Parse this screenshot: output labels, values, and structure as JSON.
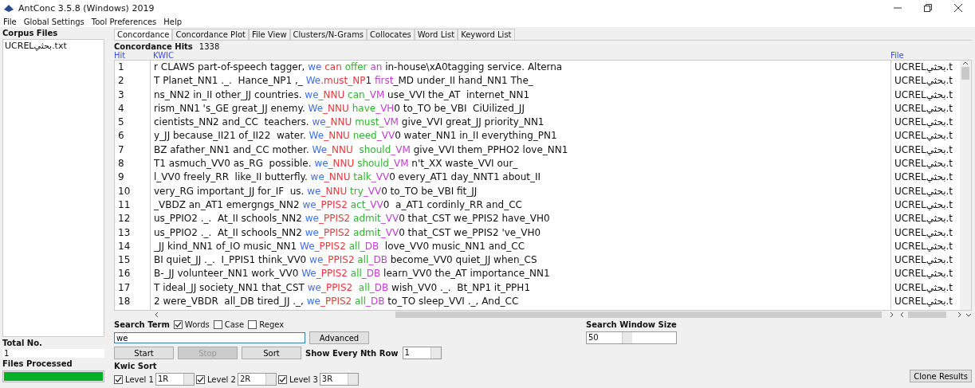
{
  "window": {
    "title": "AntConc 3.5.8 (Windows) 2019"
  },
  "menu": [
    "File",
    "Global Settings",
    "Tool Preferences",
    "Help"
  ],
  "sidebar": {
    "title": "Corpus Files",
    "files": [
      "UCRELبحثي.txt"
    ],
    "total_label": "Total No.",
    "total_value": "1",
    "processed_label": "Files Processed",
    "progress": {
      "level": 1
    }
  },
  "tabs": [
    {
      "label": "Concordance",
      "selected": true
    },
    {
      "label": "Concordance Plot",
      "selected": false
    },
    {
      "label": "File View",
      "selected": false
    },
    {
      "label": "Clusters/N-Grams",
      "selected": false
    },
    {
      "label": "Collocates",
      "selected": false
    },
    {
      "label": "Word List",
      "selected": false
    },
    {
      "label": "Keyword List",
      "selected": false
    }
  ],
  "hits": {
    "label": "Concordance Hits",
    "value": "1338"
  },
  "table": {
    "columns": [
      "Hit",
      "KWIC",
      "File"
    ],
    "rows": [
      {
        "hit": "1",
        "left": "r CLAWS part-of-speech tagger, ",
        "kwic": [
          {
            "text": "we",
            "color": "#3f6fe8"
          },
          {
            "text": " can",
            "color": "#e8383d"
          },
          {
            "text": " offer",
            "color": "#2fb52f"
          },
          {
            "text": " an",
            "color": "#c040d0"
          }
        ],
        "right": " in-house\\xA0tagging service. Alterna",
        "file": "UCRELبحثي.t"
      },
      {
        "hit": "2",
        "left": "T Planet_NN1 ._.  Hance_NP1 ,_ ",
        "kwic": [
          {
            "text": "We",
            "color": "#3f6fe8"
          },
          {
            "text": ".must_NP",
            "color": "#e8383d"
          },
          {
            "text": "1 ",
            "color": "#222222"
          },
          {
            "text": "first",
            "color": "#c040d0"
          }
        ],
        "right": "_MD under_II hand_NN1 The_",
        "file": "UCRELبحثي.t"
      },
      {
        "hit": "3",
        "left": "ns_NN2 in_II other_JJ countries. ",
        "kwic": [
          {
            "text": "we",
            "color": "#3f6fe8"
          },
          {
            "text": "_NNU",
            "color": "#e8383d"
          },
          {
            "text": " can",
            "color": "#2fb52f"
          },
          {
            "text": "_VM",
            "color": "#c040d0"
          }
        ],
        "right": " use_VVI the_AT  internet_NN1",
        "file": "UCRELبحثي.t"
      },
      {
        "hit": "4",
        "left": "rism_NN1 's_GE great_JJ enemy. ",
        "kwic": [
          {
            "text": "We",
            "color": "#3f6fe8"
          },
          {
            "text": "_NNU",
            "color": "#e8383d"
          },
          {
            "text": " have",
            "color": "#2fb52f"
          },
          {
            "text": "_VH",
            "color": "#c040d0"
          }
        ],
        "right": "0 to_TO be_VBI  CiUilized_JJ",
        "file": "UCRELبحثي.t"
      },
      {
        "hit": "5",
        "left": "cientists_NN2 and_CC  teachers. ",
        "kwic": [
          {
            "text": "we",
            "color": "#3f6fe8"
          },
          {
            "text": "_NNU",
            "color": "#e8383d"
          },
          {
            "text": " must",
            "color": "#2fb52f"
          },
          {
            "text": "_VM",
            "color": "#c040d0"
          }
        ],
        "right": " give_VVI great_JJ priority_NN1",
        "file": "UCRELبحثي.t"
      },
      {
        "hit": "6",
        "left": "y_JJ because_II21 of_II22  water. ",
        "kwic": [
          {
            "text": "We",
            "color": "#3f6fe8"
          },
          {
            "text": "_NNU",
            "color": "#e8383d"
          },
          {
            "text": " need",
            "color": "#2fb52f"
          },
          {
            "text": "_VV",
            "color": "#c040d0"
          }
        ],
        "right": "0 water_NN1 in_II everything_PN1",
        "file": "UCRELبحثي.t"
      },
      {
        "hit": "7",
        "left": "BZ afather_NN1 and_CC mother. ",
        "kwic": [
          {
            "text": "We",
            "color": "#3f6fe8"
          },
          {
            "text": "_NNU",
            "color": "#e8383d"
          },
          {
            "text": "  should",
            "color": "#2fb52f"
          },
          {
            "text": "_VM",
            "color": "#c040d0"
          }
        ],
        "right": " give_VVI them_PPHO2 love_NN1",
        "file": "UCRELبحثي.t"
      },
      {
        "hit": "8",
        "left": "T1 asmuch_VV0 as_RG  possible. ",
        "kwic": [
          {
            "text": "we",
            "color": "#3f6fe8"
          },
          {
            "text": "_NNU",
            "color": "#e8383d"
          },
          {
            "text": " should",
            "color": "#2fb52f"
          },
          {
            "text": "_VM",
            "color": "#c040d0"
          }
        ],
        "right": " n't_XX waste_VVI our_",
        "file": "UCRELبحثي.t"
      },
      {
        "hit": "9",
        "left": "l_VV0 freely_RR  like_II butterfly. ",
        "kwic": [
          {
            "text": "we",
            "color": "#3f6fe8"
          },
          {
            "text": "_NNU",
            "color": "#e8383d"
          },
          {
            "text": " talk",
            "color": "#2fb52f"
          },
          {
            "text": "_VV",
            "color": "#c040d0"
          }
        ],
        "right": "0 every_AT1 day_NNT1 about_II",
        "file": "UCRELبحثي.t"
      },
      {
        "hit": "10",
        "left": "very_RG important_JJ for_IF  us. ",
        "kwic": [
          {
            "text": "we",
            "color": "#3f6fe8"
          },
          {
            "text": "_NNU",
            "color": "#e8383d"
          },
          {
            "text": " try",
            "color": "#2fb52f"
          },
          {
            "text": "_VV",
            "color": "#c040d0"
          }
        ],
        "right": "0 to_TO be_VBI fit_JJ",
        "file": "UCRELبحثي.t"
      },
      {
        "hit": "11",
        "left": "_VBDZ an_AT1 emergngs_NN2 ",
        "kwic": [
          {
            "text": "we",
            "color": "#3f6fe8"
          },
          {
            "text": "_PPIS2",
            "color": "#e8383d"
          },
          {
            "text": " act",
            "color": "#2fb52f"
          },
          {
            "text": "_VV",
            "color": "#c040d0"
          }
        ],
        "right": "0  a_AT1 cordinly_RR and_CC",
        "file": "UCRELبحثي.t"
      },
      {
        "hit": "12",
        "left": "us_PPIO2 ._.  At_II schools_NN2 ",
        "kwic": [
          {
            "text": "we",
            "color": "#3f6fe8"
          },
          {
            "text": "_PPIS2",
            "color": "#e8383d"
          },
          {
            "text": " admit",
            "color": "#2fb52f"
          },
          {
            "text": "_VV",
            "color": "#c040d0"
          }
        ],
        "right": "0 that_CST we_PPIS2 have_VH0",
        "file": "UCRELبحثي.t"
      },
      {
        "hit": "13",
        "left": "us_PPIO2 ._.  At_II schools_NN2 ",
        "kwic": [
          {
            "text": "we",
            "color": "#3f6fe8"
          },
          {
            "text": "_PPIS2",
            "color": "#e8383d"
          },
          {
            "text": " admit",
            "color": "#2fb52f"
          },
          {
            "text": "_VV",
            "color": "#c040d0"
          }
        ],
        "right": "0 that_CST we_PPIS2 've_VH0",
        "file": "UCRELبحثي.t"
      },
      {
        "hit": "14",
        "left": "_JJ kind_NN1 of_IO music_NN1 ",
        "kwic": [
          {
            "text": "We",
            "color": "#3f6fe8"
          },
          {
            "text": "_PPIS2",
            "color": "#e8383d"
          },
          {
            "text": " all",
            "color": "#2fb52f"
          },
          {
            "text": "_DB",
            "color": "#c040d0"
          }
        ],
        "right": "  love_VV0 music_NN1 and_CC",
        "file": "UCRELبحثي.t"
      },
      {
        "hit": "15",
        "left": "BI quiet_JJ ._.  I_PPIS1 think_VV0 ",
        "kwic": [
          {
            "text": "we",
            "color": "#3f6fe8"
          },
          {
            "text": "_PPIS2",
            "color": "#e8383d"
          },
          {
            "text": " all",
            "color": "#2fb52f"
          },
          {
            "text": "_DB",
            "color": "#c040d0"
          }
        ],
        "right": " become_VV0 quiet_JJ when_CS",
        "file": "UCRELبحثي.t"
      },
      {
        "hit": "16",
        "left": "B-_JJ volunteer_NN1 work_VV0 ",
        "kwic": [
          {
            "text": "We",
            "color": "#3f6fe8"
          },
          {
            "text": "_PPIS2",
            "color": "#e8383d"
          },
          {
            "text": " all",
            "color": "#2fb52f"
          },
          {
            "text": "_DB",
            "color": "#c040d0"
          }
        ],
        "right": " learn_VV0 the_AT importance_NN1",
        "file": "UCRELبحثي.t"
      },
      {
        "hit": "17",
        "left": "T ideal_JJ society_NN1 that_CST ",
        "kwic": [
          {
            "text": "we",
            "color": "#3f6fe8"
          },
          {
            "text": "_PPIS2",
            "color": "#e8383d"
          },
          {
            "text": "  all",
            "color": "#2fb52f"
          },
          {
            "text": "_DB",
            "color": "#c040d0"
          }
        ],
        "right": " wish_VV0 ._.  Bt_NP1 it_PPH1",
        "file": "UCRELبحثي.t"
      },
      {
        "hit": "18",
        "left": "2 were_VBDR  all_DB tired_JJ ._, ",
        "kwic": [
          {
            "text": "we",
            "color": "#3f6fe8"
          },
          {
            "text": "_PPIS2",
            "color": "#e8383d"
          },
          {
            "text": " all",
            "color": "#2fb52f"
          },
          {
            "text": "_DB",
            "color": "#c040d0"
          }
        ],
        "right": " to_TO sleep_VVI ._, And_CC",
        "file": "UCRELبحثي.t"
      }
    ]
  },
  "search": {
    "label": "Search Term",
    "options": [
      {
        "label": "Words",
        "checked": true
      },
      {
        "label": "Case",
        "checked": false
      },
      {
        "label": "Regex",
        "checked": false
      }
    ],
    "value": "we",
    "advanced": "Advanced"
  },
  "buttons": [
    {
      "label": "Start",
      "disabled": false
    },
    {
      "label": "Stop",
      "disabled": true
    },
    {
      "label": "Sort",
      "disabled": false
    }
  ],
  "nth_row": {
    "label": "Show Every Nth Row",
    "value": "1"
  },
  "window_size": {
    "label": "Search Window Size",
    "value": "50"
  },
  "kwic_sort": {
    "label": "Kwic Sort",
    "levels": [
      {
        "label": "Level 1",
        "checked": true,
        "value": "1R"
      },
      {
        "label": "Level 2",
        "checked": true,
        "value": "2R"
      },
      {
        "label": "Level 3",
        "checked": true,
        "value": "3R"
      }
    ]
  },
  "clone": "Clone Results"
}
